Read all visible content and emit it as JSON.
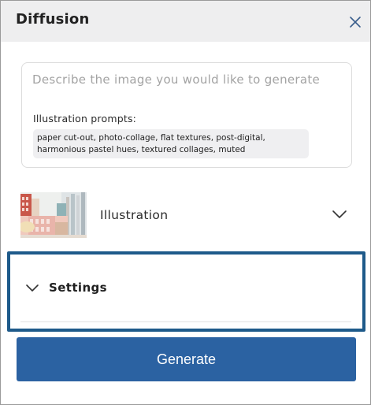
{
  "panel": {
    "title": "Diffusion",
    "close_icon": "close-icon"
  },
  "prompt": {
    "placeholder": "Describe the image you would like to generate",
    "value": "",
    "suggestions_label": "Illustration prompts:",
    "suggestion_text": "paper cut-out, photo-collage, flat textures, post-digital, harmonious pastel hues, textured collages, muted"
  },
  "style": {
    "label": "Illustration",
    "thumbnail_icon": "illustration-thumbnail",
    "chevron_icon": "chevron-down-icon"
  },
  "settings": {
    "label": "Settings",
    "chevron_icon": "chevron-down-icon",
    "highlight_color": "#1e5a8a"
  },
  "actions": {
    "generate_label": "Generate",
    "generate_color": "#2b62a2"
  }
}
